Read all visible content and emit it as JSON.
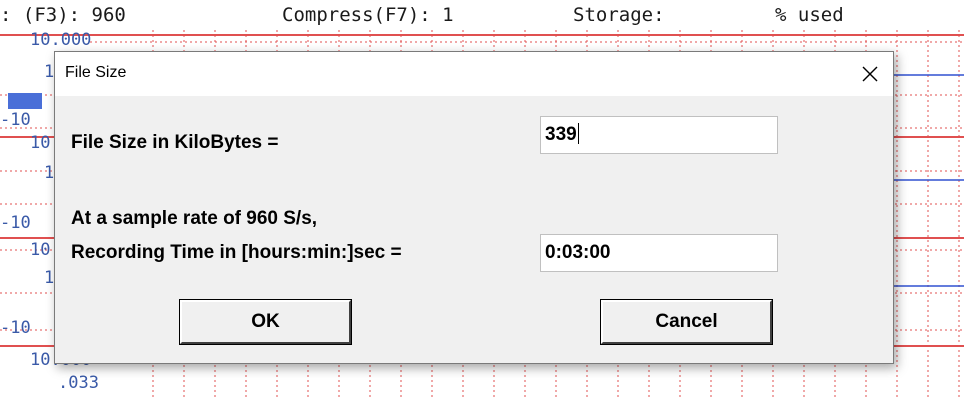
{
  "background": {
    "status": {
      "sample_rate": ": (F3): 960",
      "compress": "Compress(F7): 1",
      "storage": "Storage:",
      "used": "% used"
    },
    "ticks": {
      "t1": "10.000",
      "t2": "1",
      "t3": "-10",
      "t4": "10",
      "t5": "1",
      "t6": "-10",
      "t7": "10",
      "t8": "1",
      "t9": "-10",
      "t10": "10.000",
      "t11": ".033"
    },
    "colors": {
      "grid": "#e05050",
      "trace": "#3050d0"
    }
  },
  "dialog": {
    "title": "File Size",
    "filesize_label": "File Size in KiloBytes =",
    "filesize_value": "339",
    "rate_line": "At a sample rate of 960 S/s,",
    "time_label": "Recording Time in [hours:min:]sec =",
    "time_value": "0:03:00",
    "ok_label": "OK",
    "cancel_label": "Cancel"
  }
}
